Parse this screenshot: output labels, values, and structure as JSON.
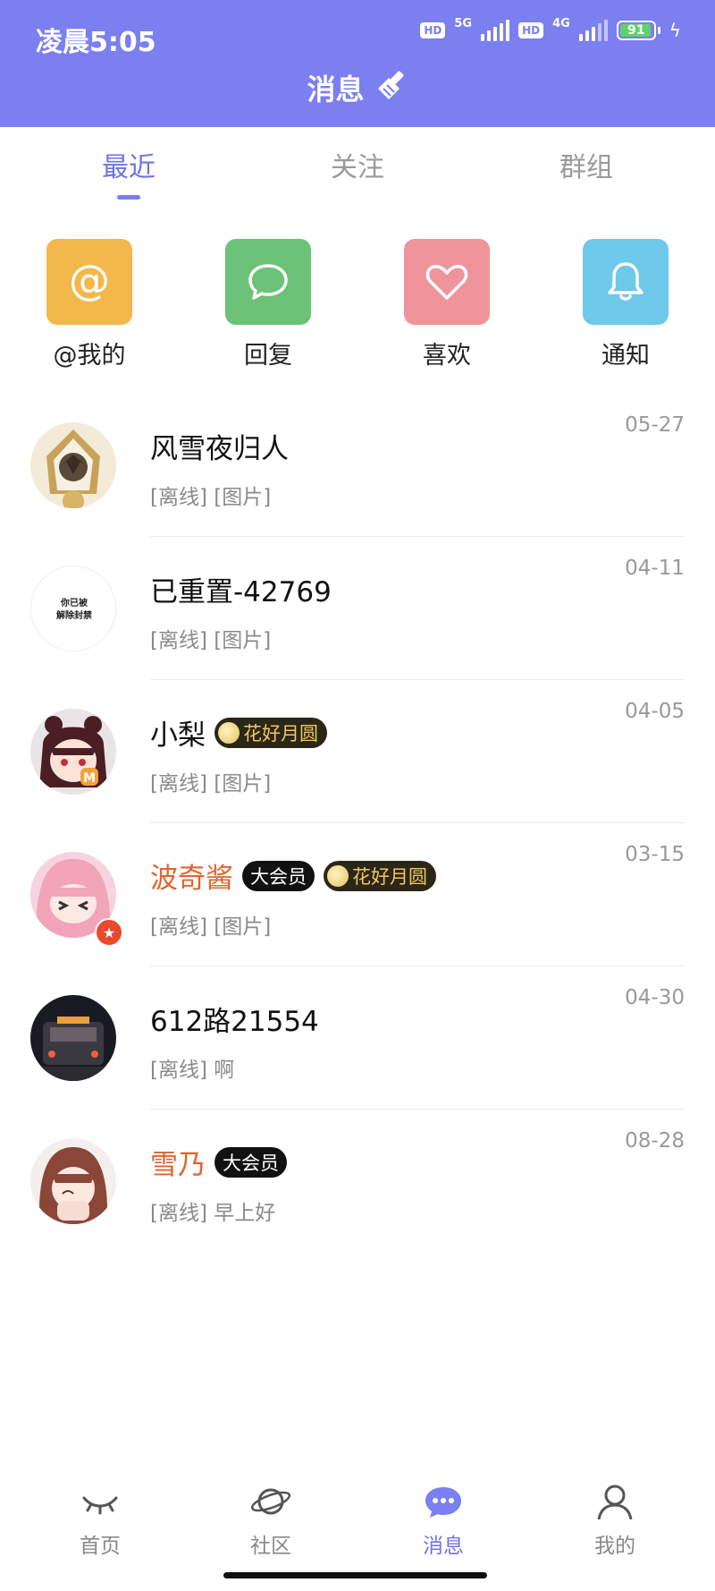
{
  "status": {
    "time": "凌晨5:05",
    "hd1": "HD",
    "net1": "5G",
    "hd2": "HD",
    "net2": "4G",
    "battery": "91",
    "battery_level": 0.91
  },
  "header": {
    "title": "消息",
    "accent": "#7b7ff0"
  },
  "tabs": [
    {
      "label": "最近",
      "active": true
    },
    {
      "label": "关注",
      "active": false
    },
    {
      "label": "群组",
      "active": false
    }
  ],
  "quick_actions": [
    {
      "label": "@我的",
      "icon": "at-icon",
      "color": "#f2b84b"
    },
    {
      "label": "回复",
      "icon": "chat-bubble-icon",
      "color": "#6cc277"
    },
    {
      "label": "喜欢",
      "icon": "heart-icon",
      "color": "#f0949c"
    },
    {
      "label": "通知",
      "icon": "bell-icon",
      "color": "#6ec8ea"
    }
  ],
  "conversations": [
    {
      "name": "风雪夜归人",
      "preview": "[离线] [图片]",
      "date": "05-27"
    },
    {
      "name": "已重置-42769",
      "preview": "[离线] [图片]",
      "date": "04-11",
      "avatar_text": "你已被 解除封禁"
    },
    {
      "name": "小梨",
      "badge_moon": "花好月圆",
      "preview": "[离线] [图片]",
      "date": "04-05"
    },
    {
      "name": "波奇酱",
      "badge_vip": "大会员",
      "badge_moon": "花好月圆",
      "preview": "[离线] [图片]",
      "date": "03-15"
    },
    {
      "name": "612路21554",
      "preview": "[离线] 啊",
      "date": "04-30"
    },
    {
      "name": "雪乃",
      "badge_vip": "大会员",
      "preview": "[离线] 早上好",
      "date": "08-28"
    }
  ],
  "bottom_nav": [
    {
      "label": "首页",
      "icon": "eye-closed-icon",
      "active": false
    },
    {
      "label": "社区",
      "icon": "planet-icon",
      "active": false
    },
    {
      "label": "消息",
      "icon": "message-icon",
      "active": true
    },
    {
      "label": "我的",
      "icon": "person-icon",
      "active": false
    }
  ]
}
